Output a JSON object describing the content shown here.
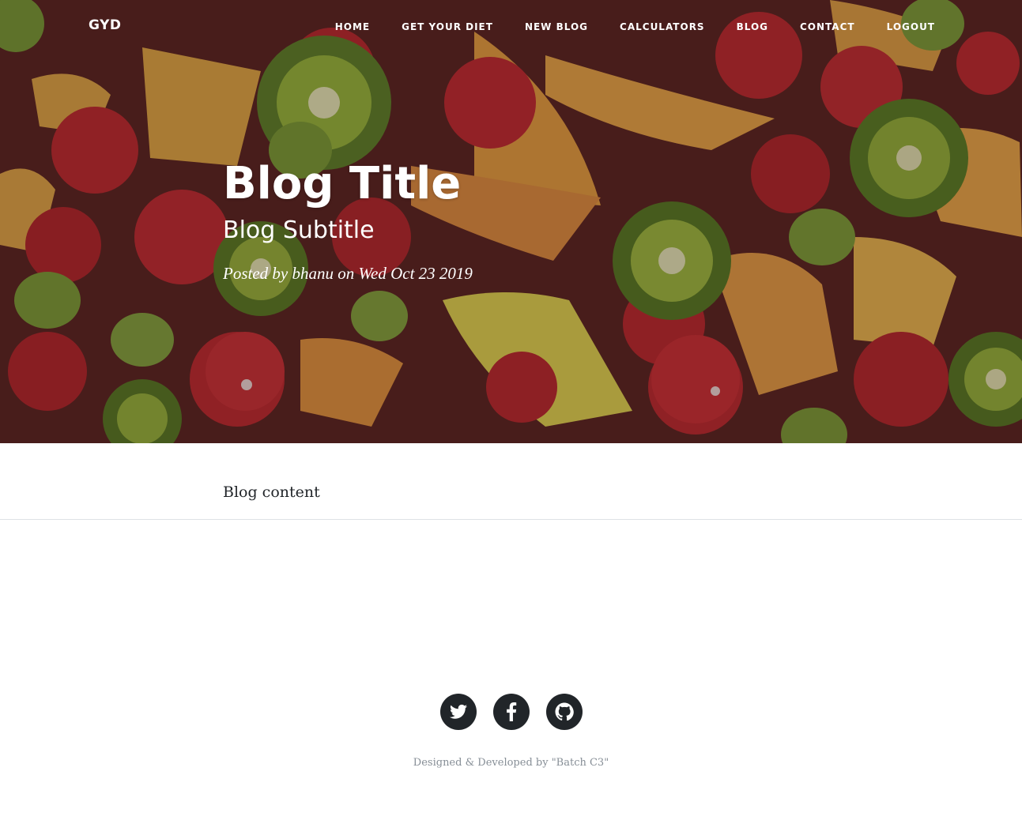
{
  "nav": {
    "brand": "GYD",
    "items": [
      {
        "label": "Home"
      },
      {
        "label": "Get Your Diet"
      },
      {
        "label": "New Blog"
      },
      {
        "label": "Calculators"
      },
      {
        "label": "Blog"
      },
      {
        "label": "Contact"
      },
      {
        "label": "Logout"
      }
    ]
  },
  "header": {
    "title": "Blog Title",
    "subtitle": "Blog Subtitle",
    "meta": "Posted by bhanu on Wed Oct 23 2019"
  },
  "post": {
    "content": "Blog content"
  },
  "footer": {
    "social": [
      {
        "icon": "twitter-icon"
      },
      {
        "icon": "facebook-icon"
      },
      {
        "icon": "github-icon"
      }
    ],
    "copyright": "Designed & Developed by \"Batch C3\""
  },
  "colors": {
    "footer_icon_bg": "#212529",
    "muted_text": "#868e96"
  }
}
